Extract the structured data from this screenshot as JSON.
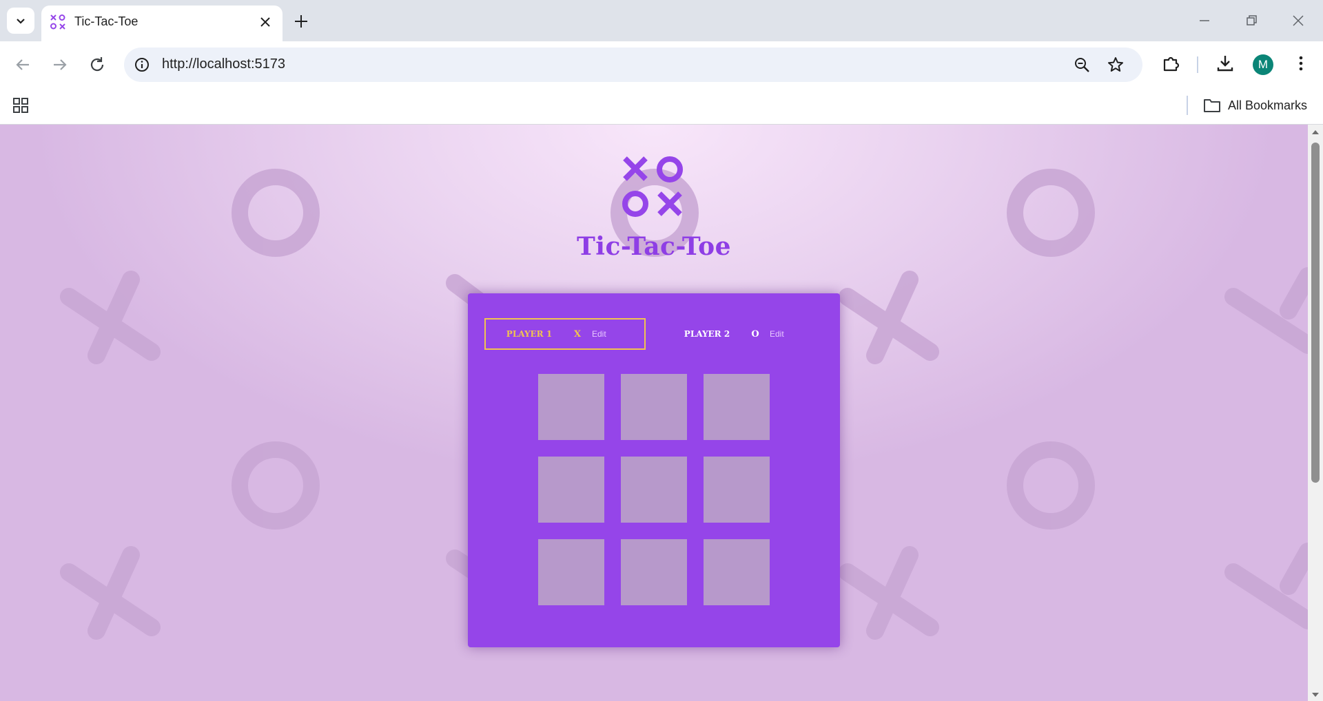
{
  "browser": {
    "tab": {
      "title": "Tic-Tac-Toe"
    },
    "omnibox": {
      "url": "http://localhost:5173"
    },
    "profile": {
      "initial": "M"
    },
    "bookmarks_bar": {
      "all_bookmarks_label": "All Bookmarks"
    }
  },
  "page": {
    "title": "Tic-Tac-Toe",
    "players": [
      {
        "name": "Player 1",
        "symbol": "X",
        "edit_label": "Edit",
        "active": true
      },
      {
        "name": "Player 2",
        "symbol": "O",
        "edit_label": "Edit",
        "active": false
      }
    ],
    "board": [
      [
        "",
        "",
        ""
      ],
      [
        "",
        "",
        ""
      ],
      [
        "",
        "",
        ""
      ]
    ]
  },
  "colors": {
    "accent": "#9545e9",
    "title": "#8e3ee5",
    "active_player": "#f1c44f",
    "cell": "#b799cb",
    "background": "#ead3f0"
  },
  "icons": [
    "tab-search-icon",
    "tictactoe-favicon",
    "close-icon",
    "plus-icon",
    "minimize-icon",
    "restore-icon",
    "window-close-icon",
    "back-arrow-icon",
    "forward-arrow-icon",
    "reload-icon",
    "site-info-icon",
    "zoom-icon",
    "star-icon",
    "extensions-icon",
    "download-icon",
    "more-vert-icon",
    "apps-grid-icon",
    "folder-icon"
  ]
}
